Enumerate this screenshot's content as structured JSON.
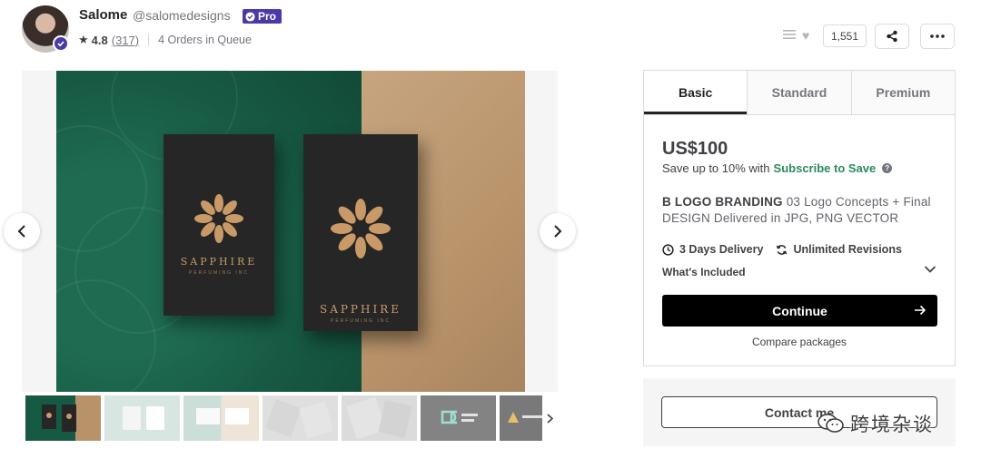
{
  "seller": {
    "name": "Salome",
    "handle": "@salomedesigns",
    "pro_label": "Pro",
    "rating": "4.8",
    "reviews": "(317)",
    "queue": "4 Orders in Queue"
  },
  "actions": {
    "likes": "1,551"
  },
  "gallery": {
    "brand_text": "SAPPHIRE",
    "brand_sub": "PERFUMING INC",
    "thumbnail_count": 7,
    "active_thumbnail": 1
  },
  "packages": {
    "tabs": [
      "Basic",
      "Standard",
      "Premium"
    ],
    "active_tab": "Basic",
    "price": "US$100",
    "save_text": "Save up to 10% with",
    "save_link": "Subscribe to Save",
    "desc_title": "B LOGO BRANDING",
    "desc_body": " 03 Logo Concepts + Final DESIGN Delivered in JPG, PNG VECTOR",
    "delivery": "3 Days Delivery",
    "revisions": "Unlimited Revisions",
    "whats_included": "What's Included",
    "continue_label": "Continue",
    "compare_label": "Compare packages"
  },
  "contact": {
    "label": "Contact me"
  },
  "watermark": {
    "text": "跨境杂谈"
  },
  "colors": {
    "pro_badge": "#4a3aa8",
    "subscribe_link": "#2b8a5e",
    "continue_button": "#000000"
  },
  "icons": [
    "star-icon",
    "verified-icon",
    "collection-icon",
    "heart-icon",
    "share-icon",
    "more-icon",
    "chevron-left-icon",
    "chevron-right-icon",
    "clock-icon",
    "refresh-icon",
    "chevron-down-icon",
    "arrow-right-icon",
    "help-icon",
    "wechat-icon"
  ]
}
